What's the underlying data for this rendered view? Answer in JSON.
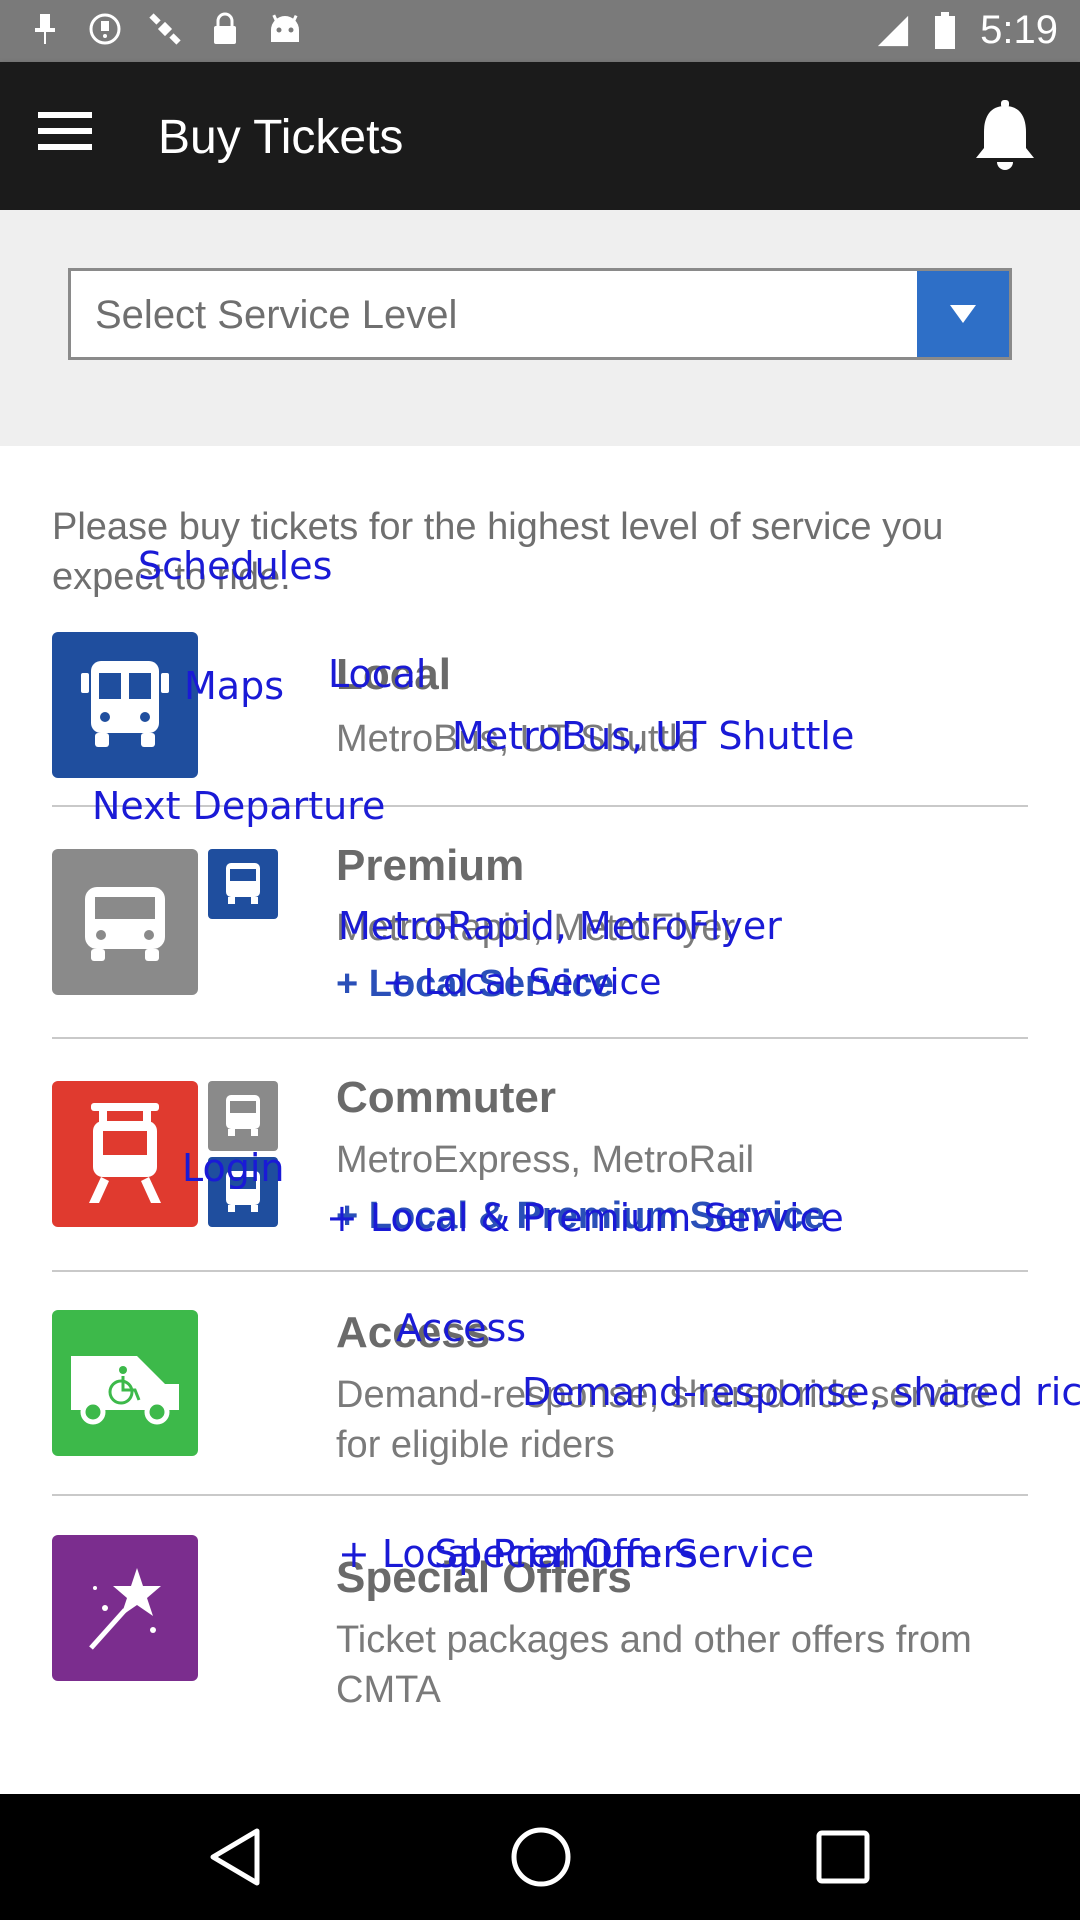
{
  "status_bar": {
    "time": "5:19",
    "icons": [
      "notification-pin-icon",
      "fake-gps-icon",
      "satellite-icon",
      "lock-icon",
      "android-icon",
      "signal-icon",
      "battery-icon"
    ]
  },
  "app_bar": {
    "title": "Buy Tickets",
    "menu_icon": "hamburger-menu-icon",
    "bell_icon": "notification-bell-icon"
  },
  "selector": {
    "placeholder": "Select Service Level",
    "arrow_color": "#2e6fc7"
  },
  "intro_text": "Please buy tickets for the highest level of service you expect to ride.",
  "rows": [
    {
      "title": "Local",
      "subtitle": "MetroBus, UT Shuttle",
      "extra": "",
      "tile_color": "#1f4e9e",
      "icon": "bus-icon"
    },
    {
      "title": "Premium",
      "subtitle": "MetroRapid, MetroFlyer",
      "extra": "+ Local Service",
      "tile_color": "#8a8a8a",
      "icon": "bus-icon"
    },
    {
      "title": "Commuter",
      "subtitle": "MetroExpress, MetroRail",
      "extra": "+ Local & Premium Service",
      "tile_color": "#e03a2f",
      "icon": "train-icon"
    },
    {
      "title": "Access",
      "subtitle": "Demand-response, shared ride service for eligible riders",
      "extra": "",
      "tile_color": "#3db94a",
      "icon": "wheelchair-van-icon"
    },
    {
      "title": "Special Offers",
      "subtitle": "Ticket packages and other offers from CMTA",
      "extra": "",
      "tile_color": "#7b2d8e",
      "icon": "star-wand-icon"
    }
  ],
  "overlays": {
    "schedules": "Schedules",
    "maps": "Maps",
    "local": "Local",
    "metrobus": "MetroBus, UT Shuttle",
    "next_departure": "Next Departure",
    "metrorapid": "MetroRapid, MetroFlyer",
    "local_service": "+ Local Service",
    "login": "Login",
    "local_premium": "+ Local & Premium Service",
    "access": "Access",
    "demand": "Demand-response, shared ric",
    "special_overlay": "+ Local Premium Service",
    "special_overlay2": "Special Offers"
  },
  "nav_bar": {
    "back_icon": "back-triangle-icon",
    "home_icon": "home-circle-icon",
    "recents_icon": "recents-square-icon"
  }
}
